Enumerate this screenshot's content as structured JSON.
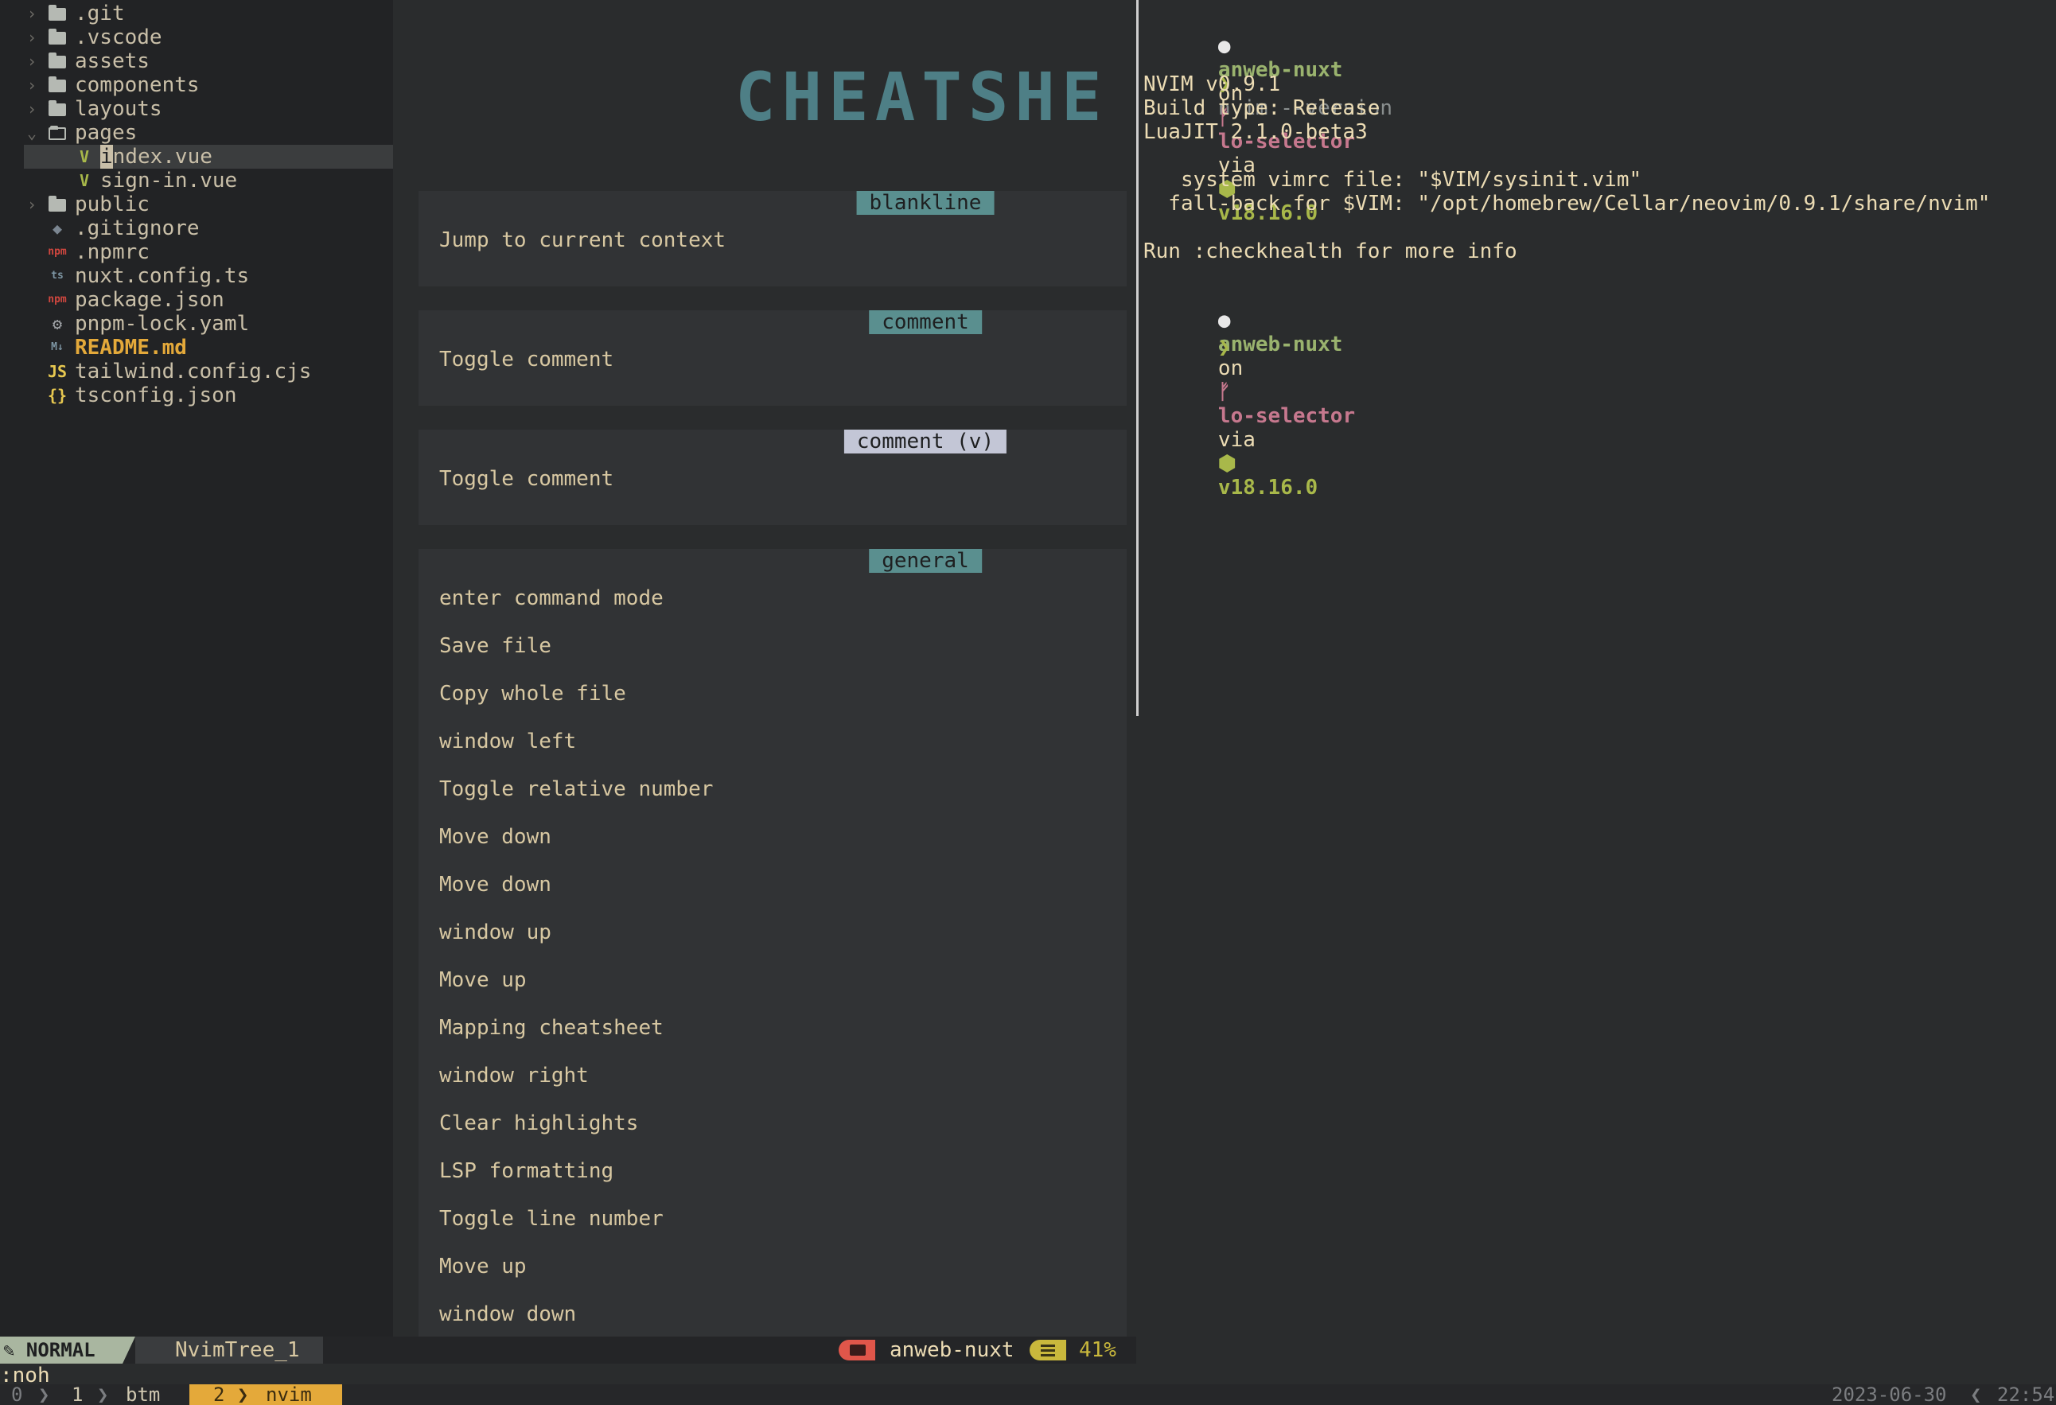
{
  "tree": {
    "items": [
      {
        "name": ".git",
        "type": "folder",
        "expanded": false
      },
      {
        "name": ".vscode",
        "type": "folder",
        "expanded": false
      },
      {
        "name": "assets",
        "type": "folder",
        "expanded": false
      },
      {
        "name": "components",
        "type": "folder",
        "expanded": false
      },
      {
        "name": "layouts",
        "type": "folder",
        "expanded": false
      },
      {
        "name": "pages",
        "type": "folder",
        "expanded": true
      },
      {
        "name": "index.vue",
        "type": "vue"
      },
      {
        "name": "sign-in.vue",
        "type": "vue"
      },
      {
        "name": "public",
        "type": "folder",
        "expanded": false
      },
      {
        "name": ".gitignore",
        "type": "git"
      },
      {
        "name": ".npmrc",
        "type": "npm"
      },
      {
        "name": "nuxt.config.ts",
        "type": "ts"
      },
      {
        "name": "package.json",
        "type": "npm"
      },
      {
        "name": "pnpm-lock.yaml",
        "type": "gear"
      },
      {
        "name": "README.md",
        "type": "md"
      },
      {
        "name": "tailwind.config.cjs",
        "type": "js"
      },
      {
        "name": "tsconfig.json",
        "type": "json"
      }
    ],
    "selected_index": 6,
    "icon_glyphs": {
      "vue": "V",
      "git": "◆",
      "npm": "npm",
      "ts": "ts",
      "gear": "⚙",
      "md": "M↓",
      "js": "JS",
      "json": "{}"
    },
    "icon_colors": {
      "vue": "#a8b84a",
      "git": "#7b8691",
      "npm": "#d0473f",
      "ts": "#7d95a3",
      "gear": "#a4a7ab",
      "md": "#7d95a3",
      "js": "#e6c750",
      "json": "#e6c750",
      "readme_text": "#e4a93a"
    }
  },
  "cheatsheet": {
    "title": "CHEATSHE",
    "sections": [
      {
        "tag": "blankline",
        "items": [
          "Jump to current context"
        ]
      },
      {
        "tag": "comment",
        "items": [
          "Toggle comment"
        ]
      },
      {
        "tag": "comment (v)",
        "items": [
          "Toggle comment"
        ]
      },
      {
        "tag": "general",
        "items": [
          "enter command mode",
          "Save file",
          "Copy whole file",
          "window left",
          "Toggle relative number",
          "Move down",
          "Move down",
          "window up",
          "Move up",
          "Mapping cheatsheet",
          "window right",
          "Clear highlights",
          "LSP formatting",
          "Toggle line number",
          "Move up",
          "window down"
        ]
      }
    ]
  },
  "terminal": {
    "prompt1": {
      "dir": "anweb-nuxt",
      "on": "on",
      "branch": "lo-selector",
      "via": "via",
      "node": "v18.16.0"
    },
    "command": "nvim --version",
    "output": [
      "NVIM v0.9.1",
      "Build type: Release",
      "LuaJIT 2.1.0-beta3",
      "",
      "   system vimrc file: \"$VIM/sysinit.vim\"",
      "  fall-back for $VIM: \"/opt/homebrew/Cellar/neovim/0.9.1/share/nvim\"",
      "",
      "Run :checkhealth for more info"
    ],
    "prompt2": {
      "dir": "anweb-nuxt",
      "on": "on",
      "branch": "lo-selector",
      "via": "via",
      "node": "v18.16.0"
    },
    "prompt_char": "❯"
  },
  "statusline": {
    "mode": "NORMAL",
    "buffer": "NvimTree_1",
    "dir": "anweb-nuxt",
    "percent": "41%"
  },
  "cmdline": ":noh",
  "tmux": {
    "session": "0",
    "windows": [
      {
        "index": "1",
        "name": "btm",
        "active": false
      },
      {
        "index": "2",
        "name": "nvim",
        "active": true
      }
    ],
    "date": "2023-06-30",
    "time": "22:54"
  }
}
